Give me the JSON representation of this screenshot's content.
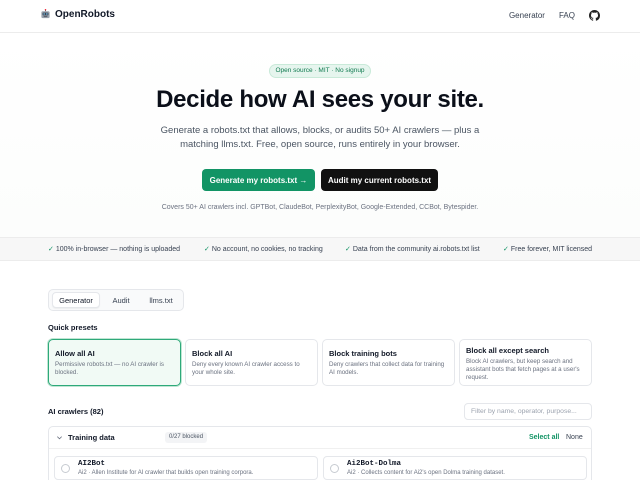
{
  "header": {
    "brand": "OpenRobots",
    "nav": [
      "Generator",
      "FAQ"
    ]
  },
  "hero": {
    "pill": "Open source · MIT · No signup",
    "headline": "Decide how AI sees your site.",
    "subline1": "Generate a robots.txt that allows, blocks, or audits 50+ AI crawlers — plus a",
    "subline2": "matching llms.txt. Free, open source, runs entirely in your browser.",
    "cta_primary": "Generate my robots.txt →",
    "cta_secondary": "Audit my current robots.txt",
    "covers": "Covers 50+ AI crawlers incl. GPTBot, ClaudeBot, PerplexityBot, Google-Extended, CCBot, Bytespider."
  },
  "features": [
    "100% in-browser — nothing is uploaded",
    "No account, no cookies, no tracking",
    "Data from the community ai.robots.txt list",
    "Free forever, MIT licensed"
  ],
  "tabs": [
    "Generator",
    "Audit",
    "llms.txt"
  ],
  "presets_label": "Quick presets",
  "presets": [
    {
      "title": "Allow all AI",
      "desc": "Permissive robots.txt — no AI crawler is blocked."
    },
    {
      "title": "Block all AI",
      "desc": "Deny every known AI crawler access to your whole site."
    },
    {
      "title": "Block training bots",
      "desc": "Deny crawlers that collect data for training AI models."
    },
    {
      "title": "Block all except search",
      "desc": "Block AI crawlers, but keep search and assistant bots that fetch pages at a user's request."
    }
  ],
  "crawlers": {
    "label": "AI crawlers (82)",
    "search_placeholder": "Filter by name, operator, purpose...",
    "group_title": "Training data",
    "group_badge": "0/27 blocked",
    "select_all": "Select all",
    "none": "None",
    "bots": [
      {
        "name": "AI2Bot",
        "desc": "Ai2 · Allen Institute for AI crawler that builds open training corpora."
      },
      {
        "name": "Ai2Bot-Dolma",
        "desc": "Ai2 · Collects content for Ai2's open Dolma training dataset."
      }
    ]
  },
  "colors": {
    "accent": "#129465",
    "dark": "#111111"
  }
}
